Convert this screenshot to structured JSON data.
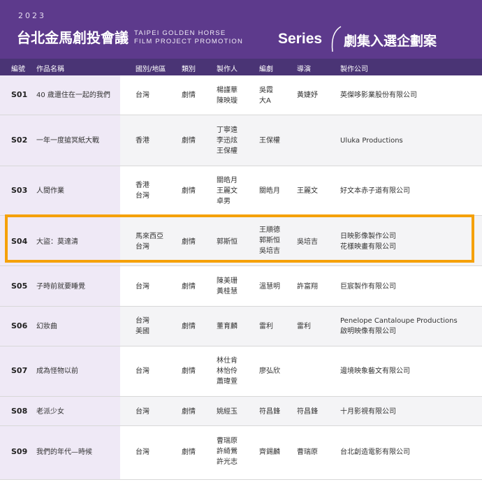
{
  "header": {
    "year": "2023",
    "title_zh": "台北金馬創投會議",
    "title_en_line1": "TAIPEI GOLDEN HORSE",
    "title_en_line2": "FILM PROJECT PROMOTION",
    "series_en": "Series",
    "series_zh": "劇集入選企劃案"
  },
  "columns": {
    "code": "編號",
    "title": "作品名稱",
    "country": "國別/地區",
    "genre": "類別",
    "producer": "製作人",
    "writer": "編劇",
    "director": "導演",
    "company": "製作公司"
  },
  "rows": [
    {
      "code": "S01",
      "title": "40 歲還住在一起的我們",
      "country": "台灣",
      "genre": "劇情",
      "producer": "楊謹華\n陳映璇",
      "writer": "吳霞\n大A",
      "director": "黃婕妤",
      "company": "英傑哆影業股份有限公司"
    },
    {
      "code": "S02",
      "title": "一年一度搶冥紙大戰",
      "country": "香港",
      "genre": "劇情",
      "producer": "丁寧遠\n李迅炫\n王保權",
      "writer": "王保權",
      "director": "",
      "company": "Uluka Productions"
    },
    {
      "code": "S03",
      "title": "人間作業",
      "country": "香港\n台灣",
      "genre": "劇情",
      "producer": "關皓月\n王麗文\n卓男",
      "writer": "關皓月",
      "director": "王麗文",
      "company": "好文本赤子道有限公司"
    },
    {
      "code": "S04",
      "title": "大盜：莫達清",
      "country": "馬來西亞\n台灣",
      "genre": "劇情",
      "producer": "郭斯恒",
      "writer": "王順德\n郭斯恒\n吳培吉",
      "director": "吳培吉",
      "company": "日映影像製作公司\n花樣映畫有限公司"
    },
    {
      "code": "S05",
      "title": "子時前就要睡覺",
      "country": "台灣",
      "genre": "劇情",
      "producer": "陳美珊\n黃桂慧",
      "writer": "溫慧明",
      "director": "許富翔",
      "company": "巨宸製作有限公司"
    },
    {
      "code": "S06",
      "title": "幻妝曲",
      "country": "台灣\n美國",
      "genre": "劇情",
      "producer": "董育麟",
      "writer": "雷利",
      "director": "雷利",
      "company": "Penelope Cantaloupe Productions\n啟明映像有限公司"
    },
    {
      "code": "S07",
      "title": "成為怪物以前",
      "country": "台灣",
      "genre": "劇情",
      "producer": "林仕肯\n林怡伶\n蕭瑋萱",
      "writer": "廖弘欣",
      "director": "",
      "company": "邊境映象藝文有限公司"
    },
    {
      "code": "S08",
      "title": "老派少女",
      "country": "台灣",
      "genre": "劇情",
      "producer": "姚經玉",
      "writer": "符昌鋒",
      "director": "符昌鋒",
      "company": "十月影視有限公司"
    },
    {
      "code": "S09",
      "title": "我們的年代—時候",
      "country": "台灣",
      "genre": "劇情",
      "producer": "曹瑞原\n許綺鶯\n許光志",
      "writer": "齊錫麟",
      "director": "曹瑞原",
      "company": "台北創造電影有限公司"
    }
  ],
  "colors": {
    "header_bg": "#5d3a8c",
    "colhead_bg": "#4a3475",
    "highlight": "#f5a10a",
    "left_band": "#efe9f6"
  }
}
